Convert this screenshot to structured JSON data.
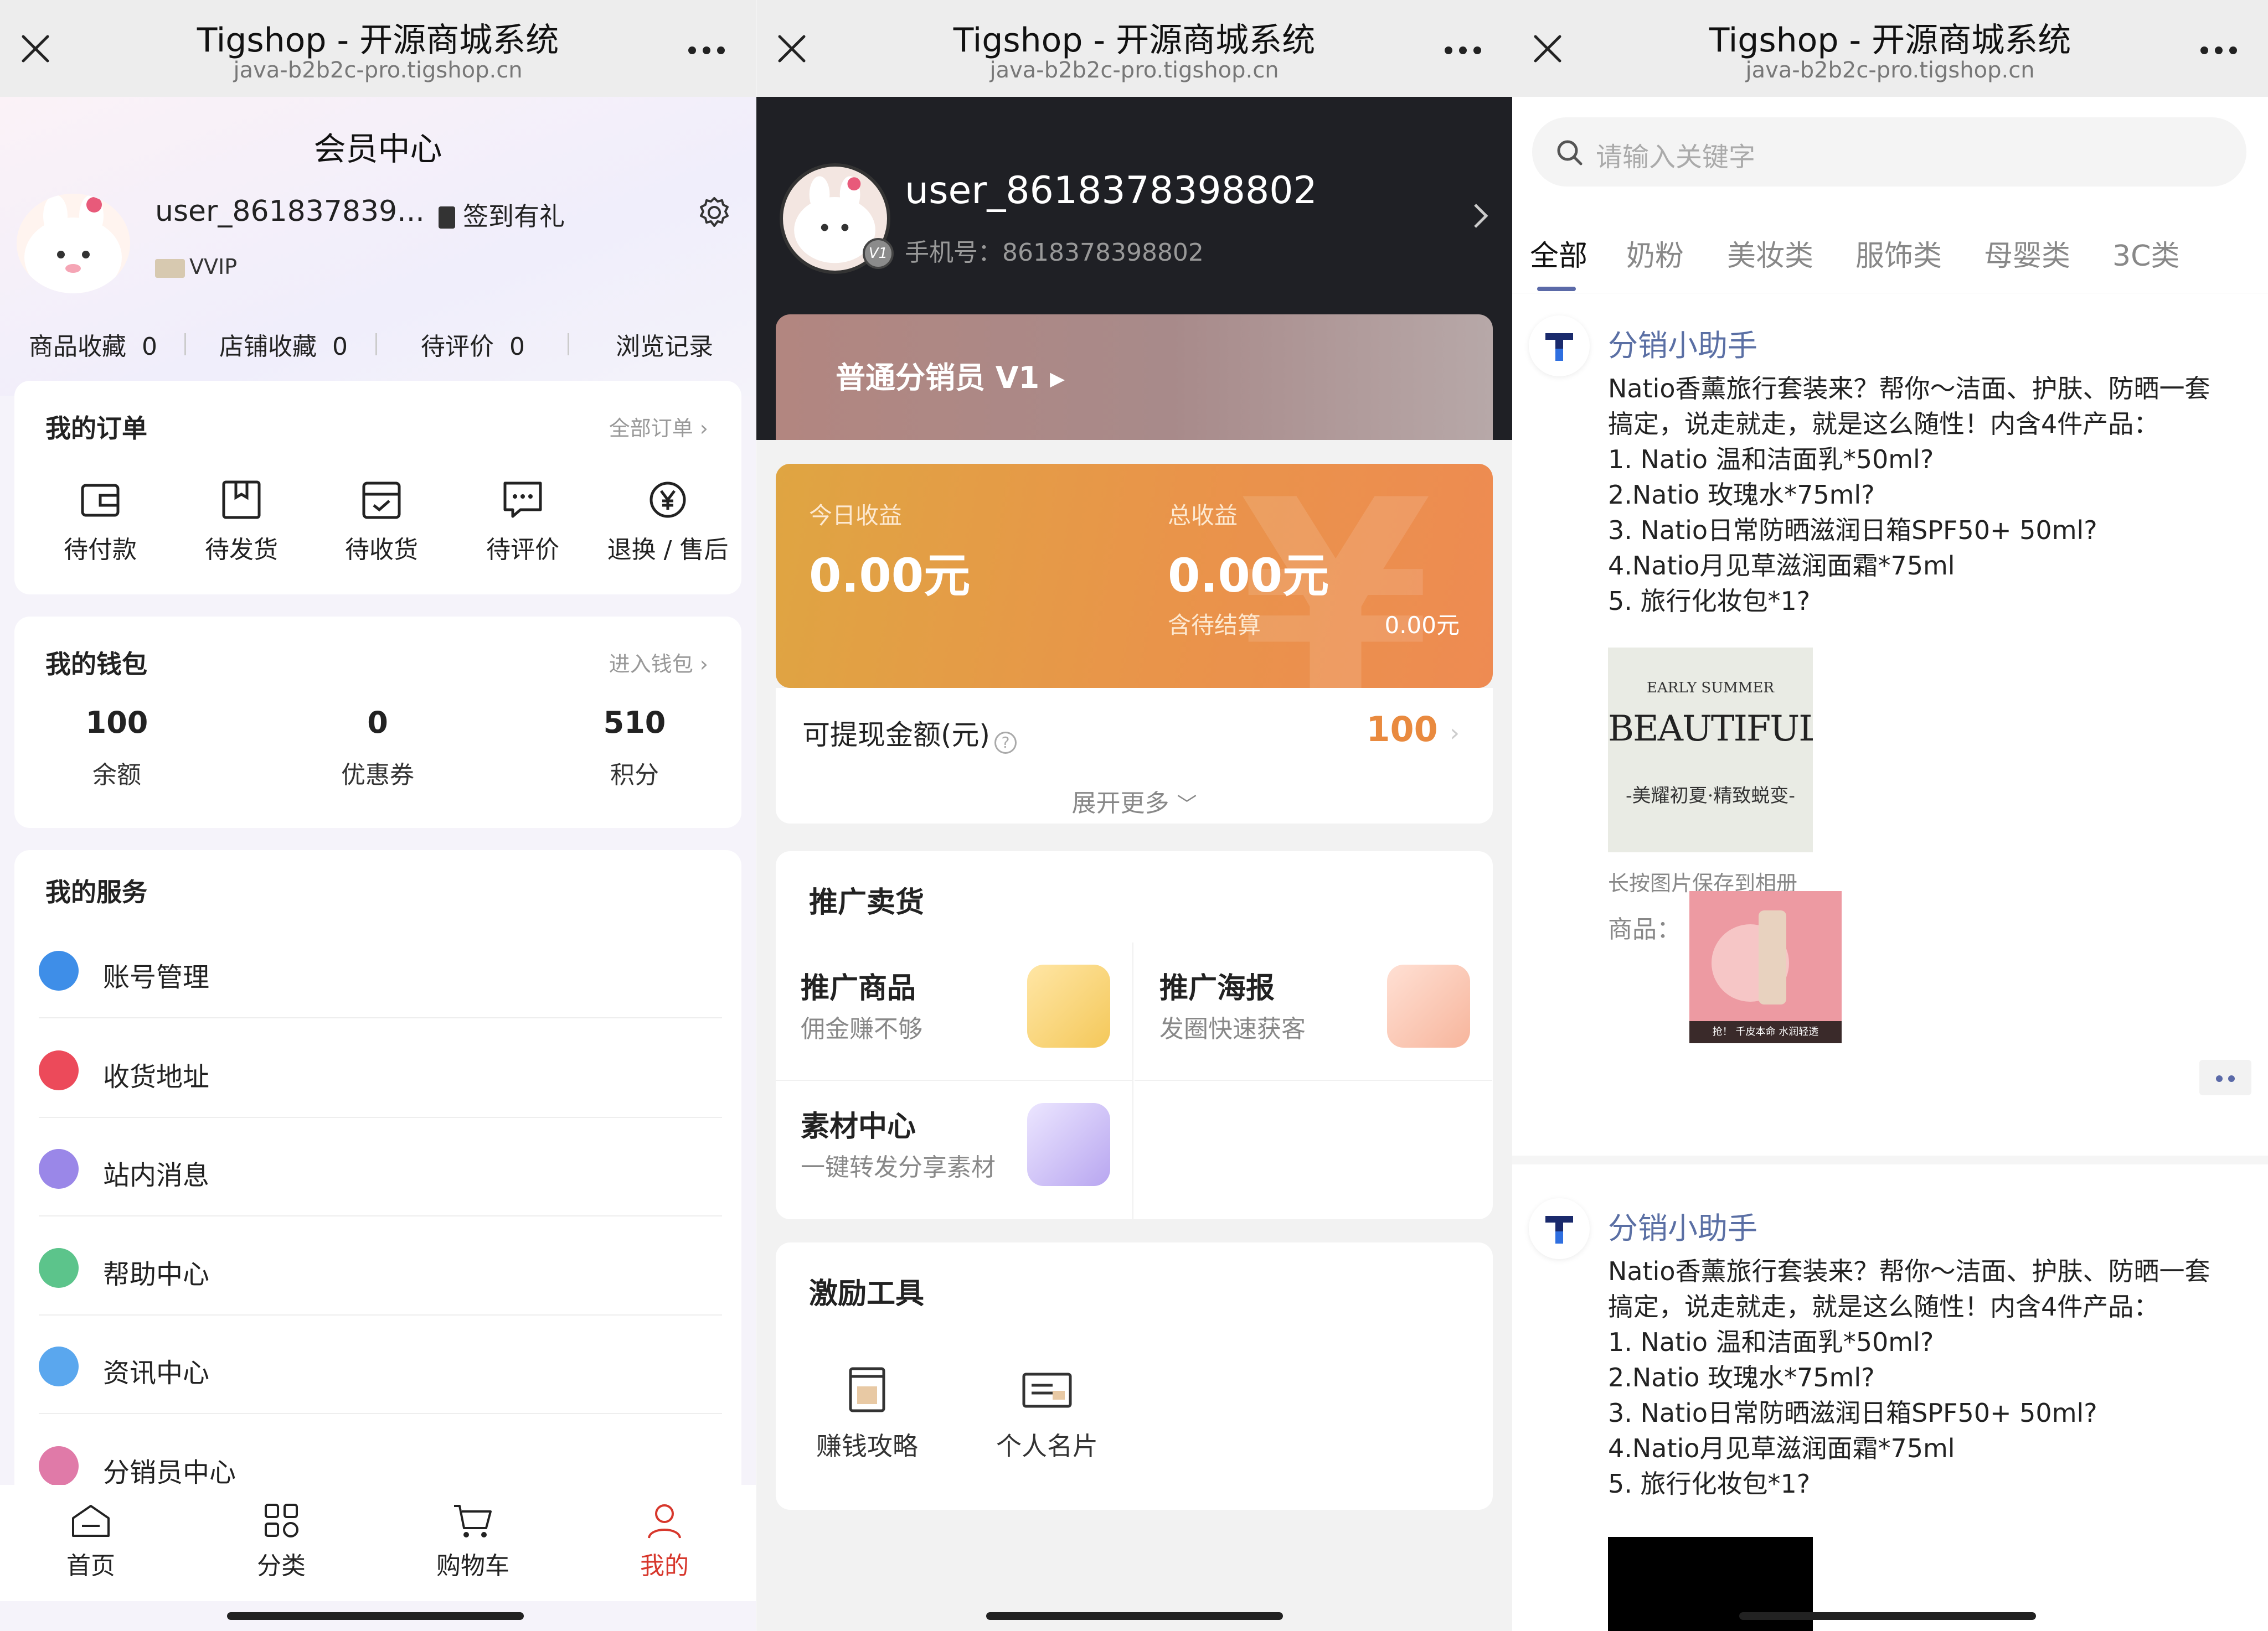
{
  "browser": {
    "title": "Tigshop - 开源商城系统",
    "url": "java-b2b2c-pro.tigshop.cn"
  },
  "member_center": {
    "header": "会员中心",
    "username": "user_861837839...",
    "level": "VVIP",
    "sign_in": "签到有礼",
    "stats": [
      {
        "label": "商品收藏",
        "value": "0"
      },
      {
        "label": "店铺收藏",
        "value": "0"
      },
      {
        "label": "待评价",
        "value": "0"
      },
      {
        "label": "浏览记录",
        "value": ""
      }
    ],
    "orders": {
      "title": "我的订单",
      "link": "全部订单 ›",
      "items": [
        "待付款",
        "待发货",
        "待收货",
        "待评价",
        "退换 / 售后"
      ]
    },
    "wallet": {
      "title": "我的钱包",
      "link": "进入钱包 ›",
      "items": [
        {
          "value": "100",
          "label": "余额"
        },
        {
          "value": "0",
          "label": "优惠券"
        },
        {
          "value": "510",
          "label": "积分"
        }
      ]
    },
    "services": {
      "title": "我的服务",
      "items": [
        "账号管理",
        "收货地址",
        "站内消息",
        "帮助中心",
        "资讯中心",
        "分销员中心"
      ]
    },
    "tabbar": [
      "首页",
      "分类",
      "购物车",
      "我的"
    ]
  },
  "distributor": {
    "username": "user_8618378398802",
    "phone": "手机号：8618378398802",
    "level_badge": "V1",
    "level_label": "普通分销员 V1 ▸",
    "today_label": "今日收益",
    "today_value": "0.00元",
    "total_label": "总收益",
    "total_value": "0.00元",
    "pending_label": "含待结算",
    "pending_value": "0.00元",
    "withdraw_label": "可提现金额(元)",
    "withdraw_value": "100",
    "expand": "展开更多",
    "promo": {
      "title": "推广卖货",
      "items": [
        {
          "title": "推广商品",
          "sub": "佣金赚不够"
        },
        {
          "title": "推广海报",
          "sub": "发圈快速获客"
        },
        {
          "title": "素材中心",
          "sub": "一键转发分享素材"
        }
      ]
    },
    "tools": {
      "title": "激励工具",
      "items": [
        "赚钱攻略",
        "个人名片"
      ]
    }
  },
  "materials": {
    "search_placeholder": "请输入关键字",
    "categories": [
      "全部",
      "奶粉",
      "美妆类",
      "服饰类",
      "母婴类",
      "3C类"
    ],
    "posts": [
      {
        "author": "分销小助手",
        "lines": [
          "Natio香薰旅行套装来？帮你～洁面、护肤、防晒一套",
          "搞定，说走就走，就是这么随性！内含4件产品：",
          "1. Natio 温和洁面乳*50ml?",
          "2.Natio 玫瑰水*75ml?",
          "3. Natio日常防晒滋润日箱SPF50+ 50ml?",
          "4.Natio月见草滋润面霜*75ml",
          "5. 旅行化妆包*1?"
        ],
        "image_text": [
          "EARLY SUMMER",
          "BEAUTIFUL",
          "-美耀初夏·精致蜕变-"
        ],
        "save_tip": "长按图片保存到相册",
        "goods_label": "商品：",
        "goods_caption": "抢！ 千皮本命 水润轻透"
      },
      {
        "author": "分销小助手",
        "lines": [
          "Natio香薰旅行套装来？帮你～洁面、护肤、防晒一套",
          "搞定，说走就走，就是这么随性！内含4件产品：",
          "1. Natio 温和洁面乳*50ml?",
          "2.Natio 玫瑰水*75ml?",
          "3. Natio日常防晒滋润日箱SPF50+ 50ml?",
          "4.Natio月见草滋润面霜*75ml",
          "5. 旅行化妆包*1?"
        ]
      }
    ]
  },
  "colors": {
    "accent_red": "#d7372c",
    "orange": "#e98a3f",
    "brand_blue": "#5a6fa4"
  }
}
